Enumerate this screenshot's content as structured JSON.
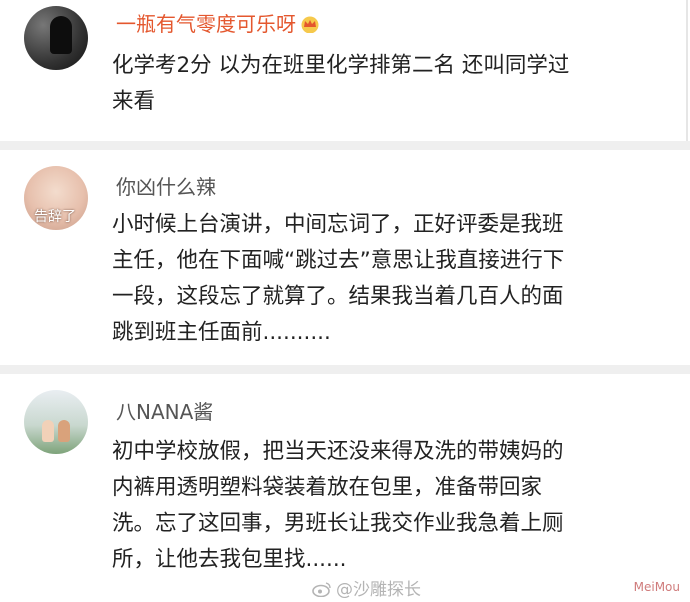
{
  "comments": [
    {
      "username": "一瓶有气零度可乐呀",
      "username_color": "#e4572e",
      "badge_icon": "crown-icon",
      "lines": [
        "化学考2分 以为在班里化学排第二名 还叫同学过",
        "来看"
      ]
    },
    {
      "username": "你凶什么辣",
      "avatar_text": "告辞了",
      "lines": [
        "小时候上台演讲，中间忘词了，正好评委是我班",
        "主任，他在下面喊“跳过去”意思让我直接进行下",
        "一段，这段忘了就算了。结果我当着几百人的面",
        "跳到班主任面前.........."
      ]
    },
    {
      "username": "八NANA酱",
      "lines": [
        "初中学校放假，把当天还没来得及洗的带姨妈的",
        "内裤用透明塑料袋装着放在包里，准备带回家",
        "洗。忘了这回事，男班长让我交作业我急着上厕",
        "所，让他去我包里找......"
      ]
    }
  ],
  "watermark": {
    "text": "@沙雕探长",
    "icon": "weibo-icon"
  },
  "corner_watermark": "MeiMou"
}
